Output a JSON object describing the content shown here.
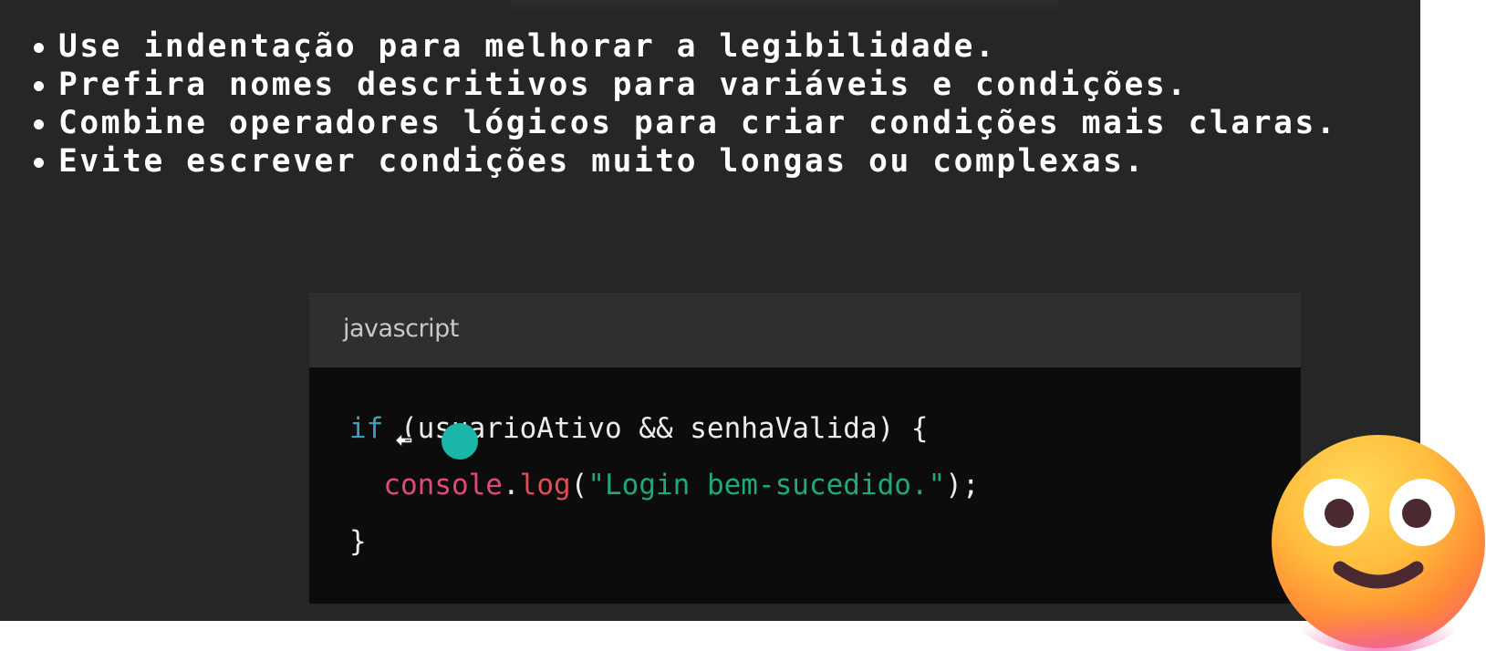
{
  "slide": {
    "bullets": [
      "Use indentação para melhorar a legibilidade.",
      "Prefira nomes descritivos para variáveis e condições.",
      "Combine operadores lógicos para criar condições mais claras.",
      "Evite escrever condições muito longas ou complexas."
    ]
  },
  "code_block": {
    "language": "javascript",
    "line1": {
      "kw": "if",
      "rest": " (usuarioAtivo && senhaValida) {"
    },
    "line2": {
      "indent": "  ",
      "obj": "console",
      "dot": ".",
      "fn": "log",
      "open": "(",
      "str": "\"Login bem-sucedido.\"",
      "close": ");"
    },
    "line3": {
      "text": "}"
    }
  },
  "overlay": {
    "cursor_icon": "hand-drag-cursor-icon",
    "click_indicator_color": "#1ab6aa",
    "emoji": "smiling-face-emoji"
  },
  "colors": {
    "slide_background": "#262626",
    "code_background": "#0c0c0c",
    "code_header": "#2f2f2f",
    "keyword": "#3b9fc2",
    "string": "#1ea97a",
    "method": "#e04d55"
  }
}
